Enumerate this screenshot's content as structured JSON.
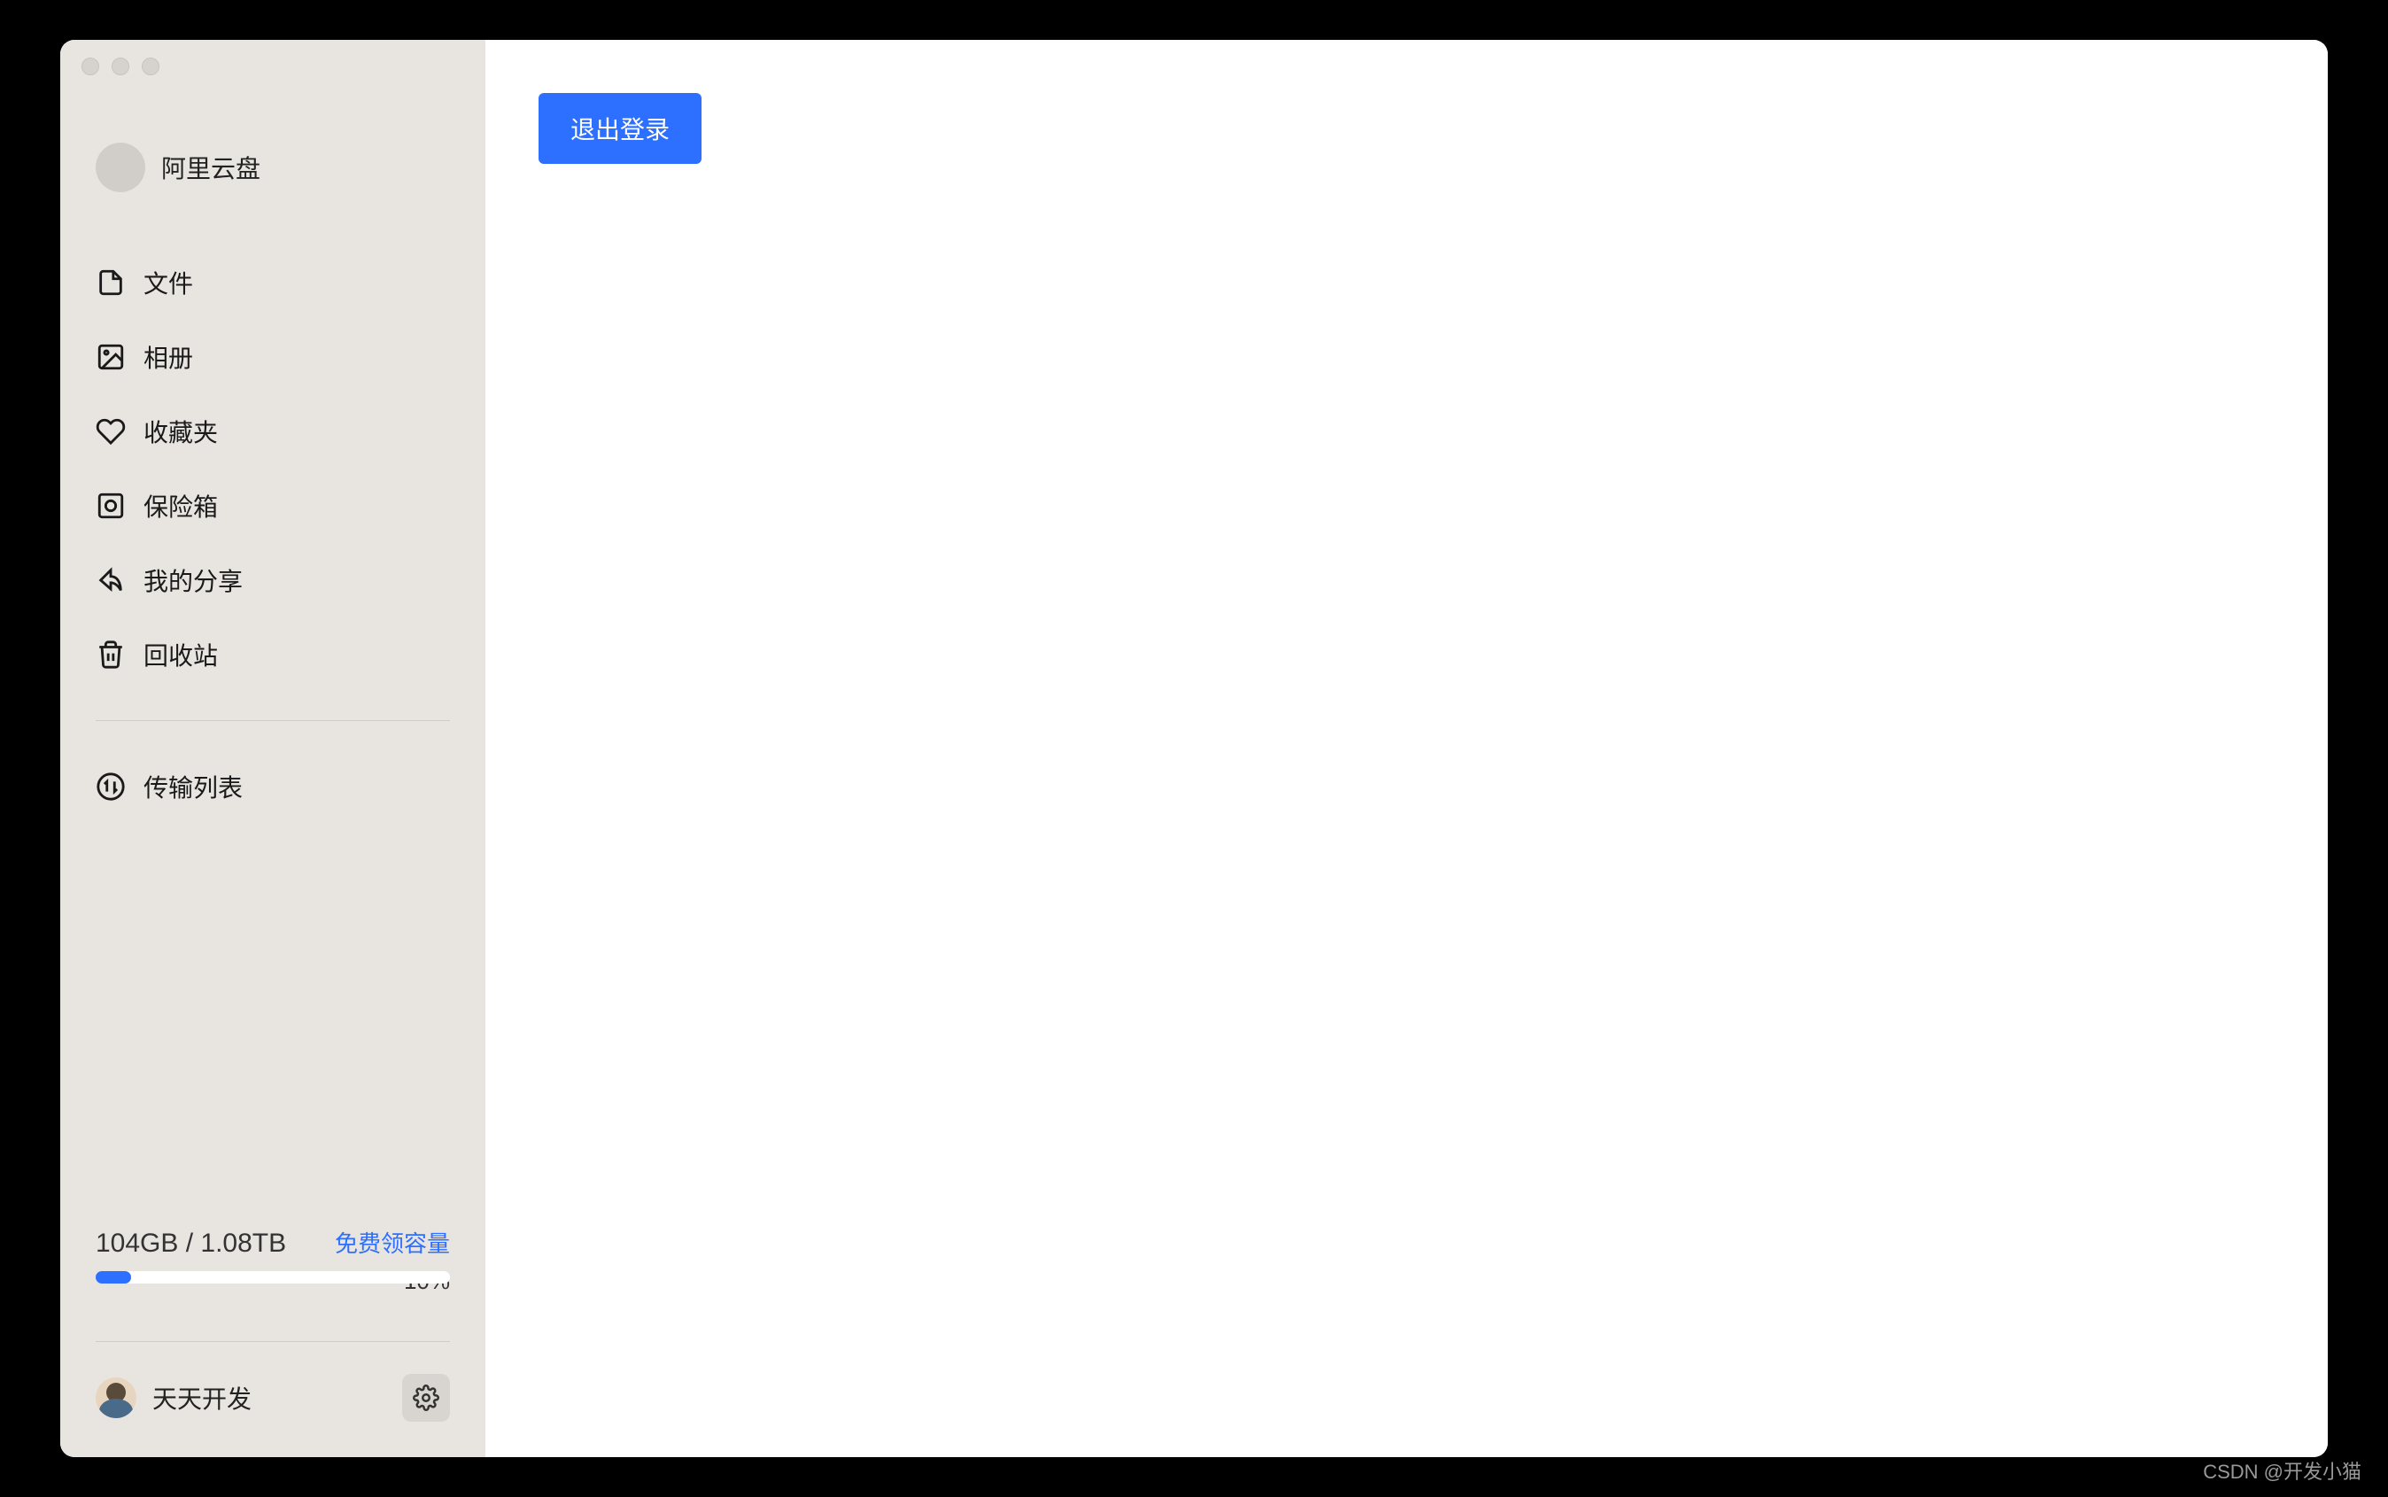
{
  "brand": {
    "name": "阿里云盘"
  },
  "sidebar": {
    "items": [
      {
        "label": "文件",
        "icon": "file-icon"
      },
      {
        "label": "相册",
        "icon": "image-icon"
      },
      {
        "label": "收藏夹",
        "icon": "heart-icon"
      },
      {
        "label": "保险箱",
        "icon": "safe-icon"
      },
      {
        "label": "我的分享",
        "icon": "share-icon"
      },
      {
        "label": "回收站",
        "icon": "trash-icon"
      }
    ],
    "transfer": {
      "label": "传输列表",
      "icon": "transfer-icon"
    }
  },
  "storage": {
    "usage_text": "104GB / 1.08TB",
    "link_text": "免费领容量",
    "percent_text": "10%",
    "percent_value": 10
  },
  "user": {
    "name": "天天开发"
  },
  "main": {
    "logout_label": "退出登录"
  },
  "watermark": "CSDN @开发小猫"
}
